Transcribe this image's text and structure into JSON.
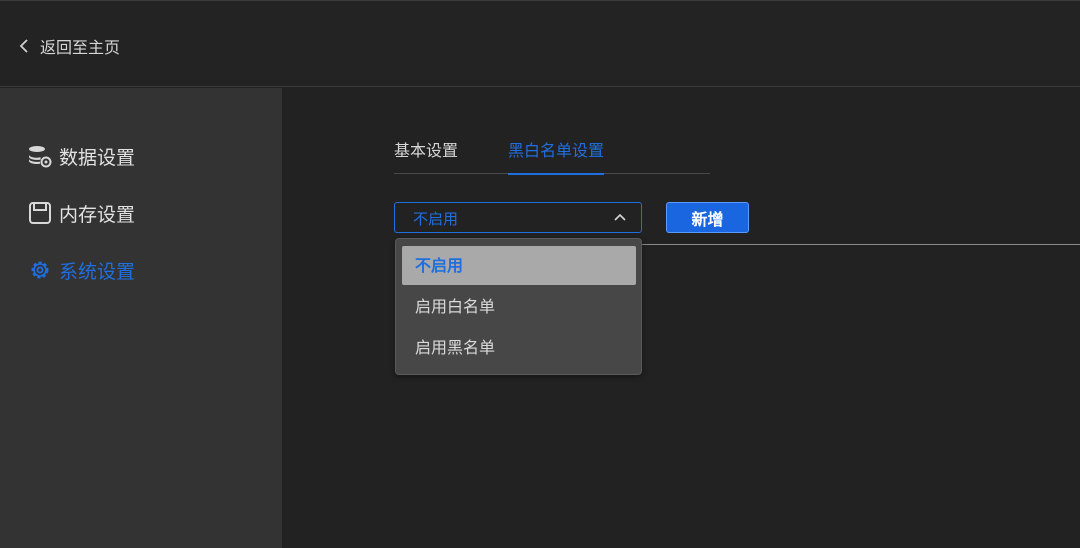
{
  "header": {
    "back_label": "返回至主页",
    "back_icon": "chevron-left-icon"
  },
  "sidebar": {
    "items": [
      {
        "label": "数据设置",
        "icon": "database-gear-icon",
        "active": false
      },
      {
        "label": "内存设置",
        "icon": "memory-icon",
        "active": false
      },
      {
        "label": "系统设置",
        "icon": "gear-icon",
        "active": true
      }
    ]
  },
  "main": {
    "tabs": [
      {
        "label": "基本设置",
        "active": false
      },
      {
        "label": "黑白名单设置",
        "active": true
      }
    ],
    "select": {
      "value": "不启用",
      "expanded": true,
      "options": [
        {
          "label": "不启用",
          "selected": true
        },
        {
          "label": "启用白名单",
          "selected": false
        },
        {
          "label": "启用黑名单",
          "selected": false
        }
      ]
    },
    "add_button_label": "新增"
  },
  "colors": {
    "accent": "#1f6fe0",
    "background": "#222222",
    "sidebar": "#333333"
  }
}
